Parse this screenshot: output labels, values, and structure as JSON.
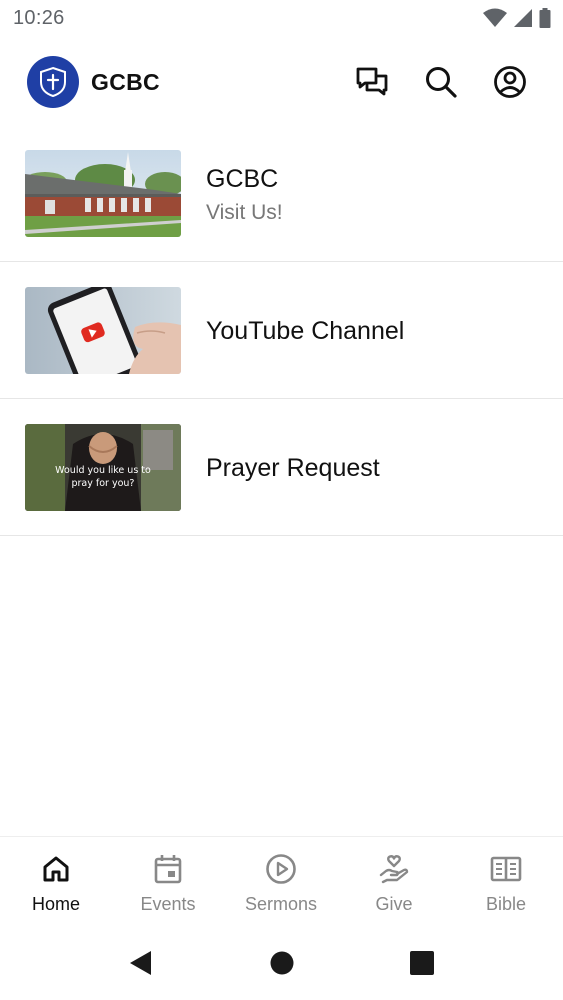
{
  "status_bar": {
    "time": "10:26",
    "icons": [
      "wifi-icon",
      "cellular-signal-icon",
      "battery-icon"
    ]
  },
  "app_bar": {
    "title": "GCBC",
    "logo_icon": "church-shield-logo",
    "actions": [
      "chat-icon",
      "search-icon",
      "account-icon"
    ]
  },
  "list": [
    {
      "title": "GCBC",
      "subtitle": "Visit Us!",
      "thumbnail": "church-building-photo"
    },
    {
      "title": "YouTube Channel",
      "thumbnail": "phone-youtube-photo"
    },
    {
      "title": "Prayer Request",
      "thumbnail": "praying-hands-photo",
      "thumbnail_caption": "Would you like us to pray for you?"
    }
  ],
  "bottom_nav": {
    "items": [
      {
        "label": "Home",
        "icon": "home-icon",
        "active": true
      },
      {
        "label": "Events",
        "icon": "calendar-icon",
        "active": false
      },
      {
        "label": "Sermons",
        "icon": "play-circle-icon",
        "active": false
      },
      {
        "label": "Give",
        "icon": "giving-hand-heart-icon",
        "active": false
      },
      {
        "label": "Bible",
        "icon": "open-book-icon",
        "active": false
      }
    ]
  },
  "system_nav": [
    "back-icon",
    "home-circle-icon",
    "recents-square-icon"
  ],
  "colors": {
    "logo_blue": "#1f3fa5",
    "text_primary": "#111111",
    "text_secondary": "#777777",
    "nav_inactive": "#888888",
    "divider": "#e6e6e6"
  }
}
